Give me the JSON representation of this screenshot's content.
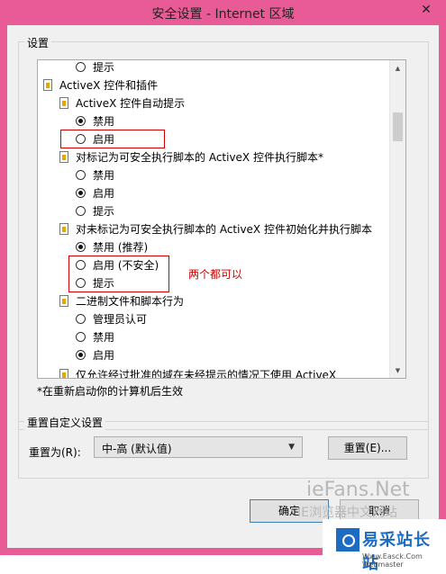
{
  "window": {
    "title": "安全设置 - Internet 区域",
    "close_glyph": "✕"
  },
  "settings_group": {
    "label": "设置"
  },
  "list": {
    "items": [
      "提示",
      "ActiveX 控件和插件",
      "ActiveX 控件自动提示",
      "禁用",
      "启用",
      "对标记为可安全执行脚本的 ActiveX 控件执行脚本*",
      "禁用",
      "启用",
      "提示",
      "对未标记为可安全执行脚本的 ActiveX 控件初始化并执行脚本",
      "禁用 (推荐)",
      "启用 (不安全)",
      "提示",
      "二进制文件和脚本行为",
      "管理员认可",
      "禁用",
      "启用",
      "仅允许经过批准的域在未经提示的情况下使用 ActiveX"
    ]
  },
  "annotation": "两个都可以",
  "restart_note": "*在重新启动你的计算机后生效",
  "reset_group": {
    "label": "重置自定义设置",
    "reset_to_label": "重置为(R):",
    "combo_value": "中-高 (默认值)",
    "reset_button": "重置(E)..."
  },
  "buttons": {
    "ok": "确定",
    "cancel": "取消"
  },
  "watermark": {
    "line1": "ieFans.Net",
    "line2": "IE浏览器中文网站"
  },
  "logo": {
    "text": "易采站长站",
    "sub": "Www.Easck.Com  Webmaster"
  }
}
